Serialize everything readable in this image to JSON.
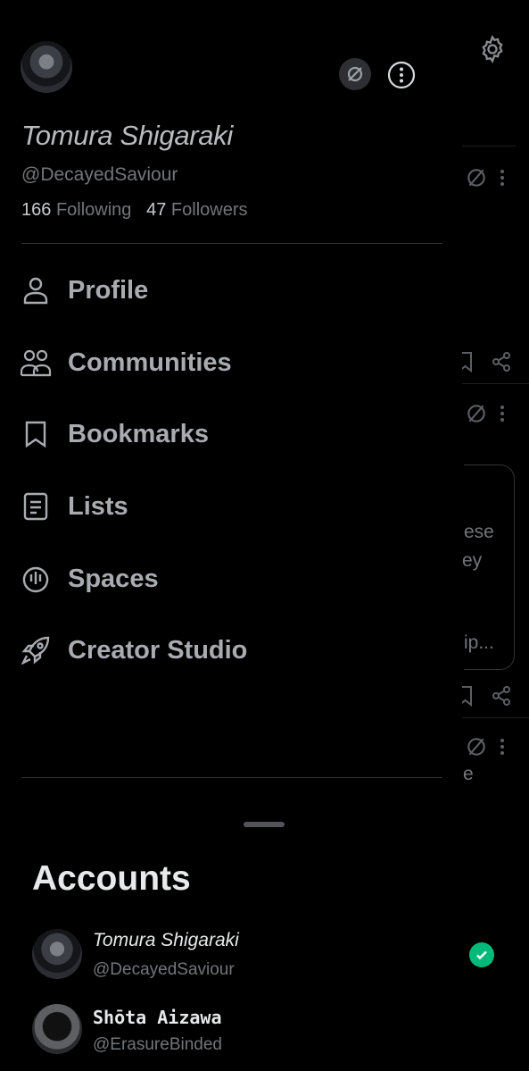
{
  "profile": {
    "display_name": "Tomura Shigaraki",
    "handle": "@DecayedSaviour",
    "following_count": "166",
    "following_label": "Following",
    "followers_count": "47",
    "followers_label": "Followers"
  },
  "menu": [
    {
      "label": "Profile",
      "icon": "person-icon"
    },
    {
      "label": "Communities",
      "icon": "communities-icon"
    },
    {
      "label": "Bookmarks",
      "icon": "bookmark-icon"
    },
    {
      "label": "Lists",
      "icon": "lists-icon"
    },
    {
      "label": "Spaces",
      "icon": "spaces-icon"
    },
    {
      "label": "Creator Studio",
      "icon": "rocket-icon"
    }
  ],
  "accounts": {
    "title": "Accounts",
    "items": [
      {
        "name": "Tomura Shigaraki",
        "handle": "@DecayedSaviour",
        "active": true
      },
      {
        "name": "Shōta Aizawa",
        "handle": "@ErasureBinded",
        "active": false
      }
    ]
  },
  "background": {
    "snippet_1": "ese",
    "snippet_2": "ey",
    "snippet_3": "ip...",
    "snippet_4": "e"
  },
  "colors": {
    "background": "#000000",
    "text_primary": "#e7e9ea",
    "text_secondary": "#71767b",
    "active_check": "#00ba7c"
  }
}
